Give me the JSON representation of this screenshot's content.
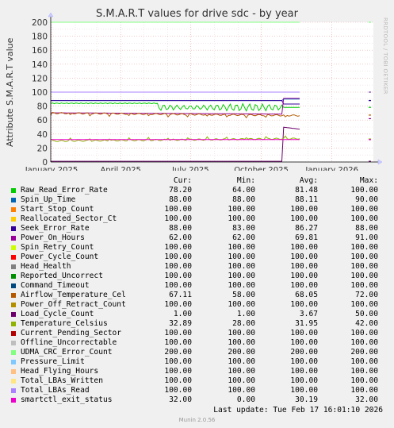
{
  "window": {
    "title": "S.M.A.R.T values for drive sdc - by year",
    "sidebar_text": "RRDTOOL / TOBI OETIKER",
    "footer": "Munin 2.0.56"
  },
  "chart_data": {
    "type": "line",
    "title": "S.M.A.R.T values for drive sdc - by year",
    "ylabel": "Attribute S.M.A.R.T value",
    "xlabel": "",
    "ylim": [
      0,
      200
    ],
    "yticks": [
      0,
      20,
      40,
      60,
      80,
      100,
      120,
      140,
      160,
      180,
      200
    ],
    "xlim": [
      "2024-12-31",
      "2026-02-24"
    ],
    "xticks": [
      {
        "label": "January 2025",
        "date": "2025-01-01"
      },
      {
        "label": "April 2025",
        "date": "2025-04-01"
      },
      {
        "label": "July 2025",
        "date": "2025-07-01"
      },
      {
        "label": "October 2025",
        "date": "2025-10-01"
      },
      {
        "label": "January 2026",
        "date": "2026-01-01"
      }
    ],
    "data_end_date": "2025-11-20",
    "columns": [
      "Cur:",
      "Min:",
      "Avg:",
      "Max:"
    ],
    "series": [
      {
        "name": "Raw_Read_Error_Rate",
        "color": "#00cc00",
        "cur": "78.20",
        "min": "64.00",
        "avg": "81.48",
        "max": "100.00"
      },
      {
        "name": "Spin_Up_Time",
        "color": "#0066b3",
        "cur": "88.00",
        "min": "88.00",
        "avg": "88.11",
        "max": "90.00"
      },
      {
        "name": "Start_Stop_Count",
        "color": "#ff8000",
        "cur": "100.00",
        "min": "100.00",
        "avg": "100.00",
        "max": "100.00"
      },
      {
        "name": "Reallocated_Sector_Ct",
        "color": "#ffcc00",
        "cur": "100.00",
        "min": "100.00",
        "avg": "100.00",
        "max": "100.00"
      },
      {
        "name": "Seek_Error_Rate",
        "color": "#330099",
        "cur": "88.00",
        "min": "83.00",
        "avg": "86.27",
        "max": "88.00"
      },
      {
        "name": "Power_On_Hours",
        "color": "#990099",
        "cur": "62.00",
        "min": "62.00",
        "avg": "69.81",
        "max": "91.00"
      },
      {
        "name": "Spin_Retry_Count",
        "color": "#ccff00",
        "cur": "100.00",
        "min": "100.00",
        "avg": "100.00",
        "max": "100.00"
      },
      {
        "name": "Power_Cycle_Count",
        "color": "#ff0000",
        "cur": "100.00",
        "min": "100.00",
        "avg": "100.00",
        "max": "100.00"
      },
      {
        "name": "Head_Health",
        "color": "#808080",
        "cur": "100.00",
        "min": "100.00",
        "avg": "100.00",
        "max": "100.00"
      },
      {
        "name": "Reported_Uncorrect",
        "color": "#008f00",
        "cur": "100.00",
        "min": "100.00",
        "avg": "100.00",
        "max": "100.00"
      },
      {
        "name": "Command_Timeout",
        "color": "#00487d",
        "cur": "100.00",
        "min": "100.00",
        "avg": "100.00",
        "max": "100.00"
      },
      {
        "name": "Airflow_Temperature_Cel",
        "color": "#b35a00",
        "cur": "67.11",
        "min": "58.00",
        "avg": "68.05",
        "max": "72.00"
      },
      {
        "name": "Power_Off_Retract_Count",
        "color": "#b38f00",
        "cur": "100.00",
        "min": "100.00",
        "avg": "100.00",
        "max": "100.00"
      },
      {
        "name": "Load_Cycle_Count",
        "color": "#6b006b",
        "cur": "1.00",
        "min": "1.00",
        "avg": "3.67",
        "max": "50.00"
      },
      {
        "name": "Temperature_Celsius",
        "color": "#8fb300",
        "cur": "32.89",
        "min": "28.00",
        "avg": "31.95",
        "max": "42.00"
      },
      {
        "name": "Current_Pending_Sector",
        "color": "#b30000",
        "cur": "100.00",
        "min": "100.00",
        "avg": "100.00",
        "max": "100.00"
      },
      {
        "name": "Offline_Uncorrectable",
        "color": "#bebebe",
        "cur": "100.00",
        "min": "100.00",
        "avg": "100.00",
        "max": "100.00"
      },
      {
        "name": "UDMA_CRC_Error_Count",
        "color": "#80ff80",
        "cur": "200.00",
        "min": "200.00",
        "avg": "200.00",
        "max": "200.00"
      },
      {
        "name": "Pressure_Limit",
        "color": "#80c9ff",
        "cur": "100.00",
        "min": "100.00",
        "avg": "100.00",
        "max": "100.00"
      },
      {
        "name": "Head_Flying_Hours",
        "color": "#ffc080",
        "cur": "100.00",
        "min": "100.00",
        "avg": "100.00",
        "max": "100.00"
      },
      {
        "name": "Total_LBAs_Written",
        "color": "#ffe680",
        "cur": "100.00",
        "min": "100.00",
        "avg": "100.00",
        "max": "100.00"
      },
      {
        "name": "Total_LBAs_Read",
        "color": "#aa80ff",
        "cur": "100.00",
        "min": "100.00",
        "avg": "100.00",
        "max": "100.00"
      },
      {
        "name": "smartctl_exit_status",
        "color": "#ee00cc",
        "cur": "32.00",
        "min": "0.00",
        "avg": "30.19",
        "max": "32.00"
      }
    ],
    "grid": true,
    "legend": "bottom"
  },
  "last_update": "Last update: Tue Feb 17 16:01:10 2026"
}
